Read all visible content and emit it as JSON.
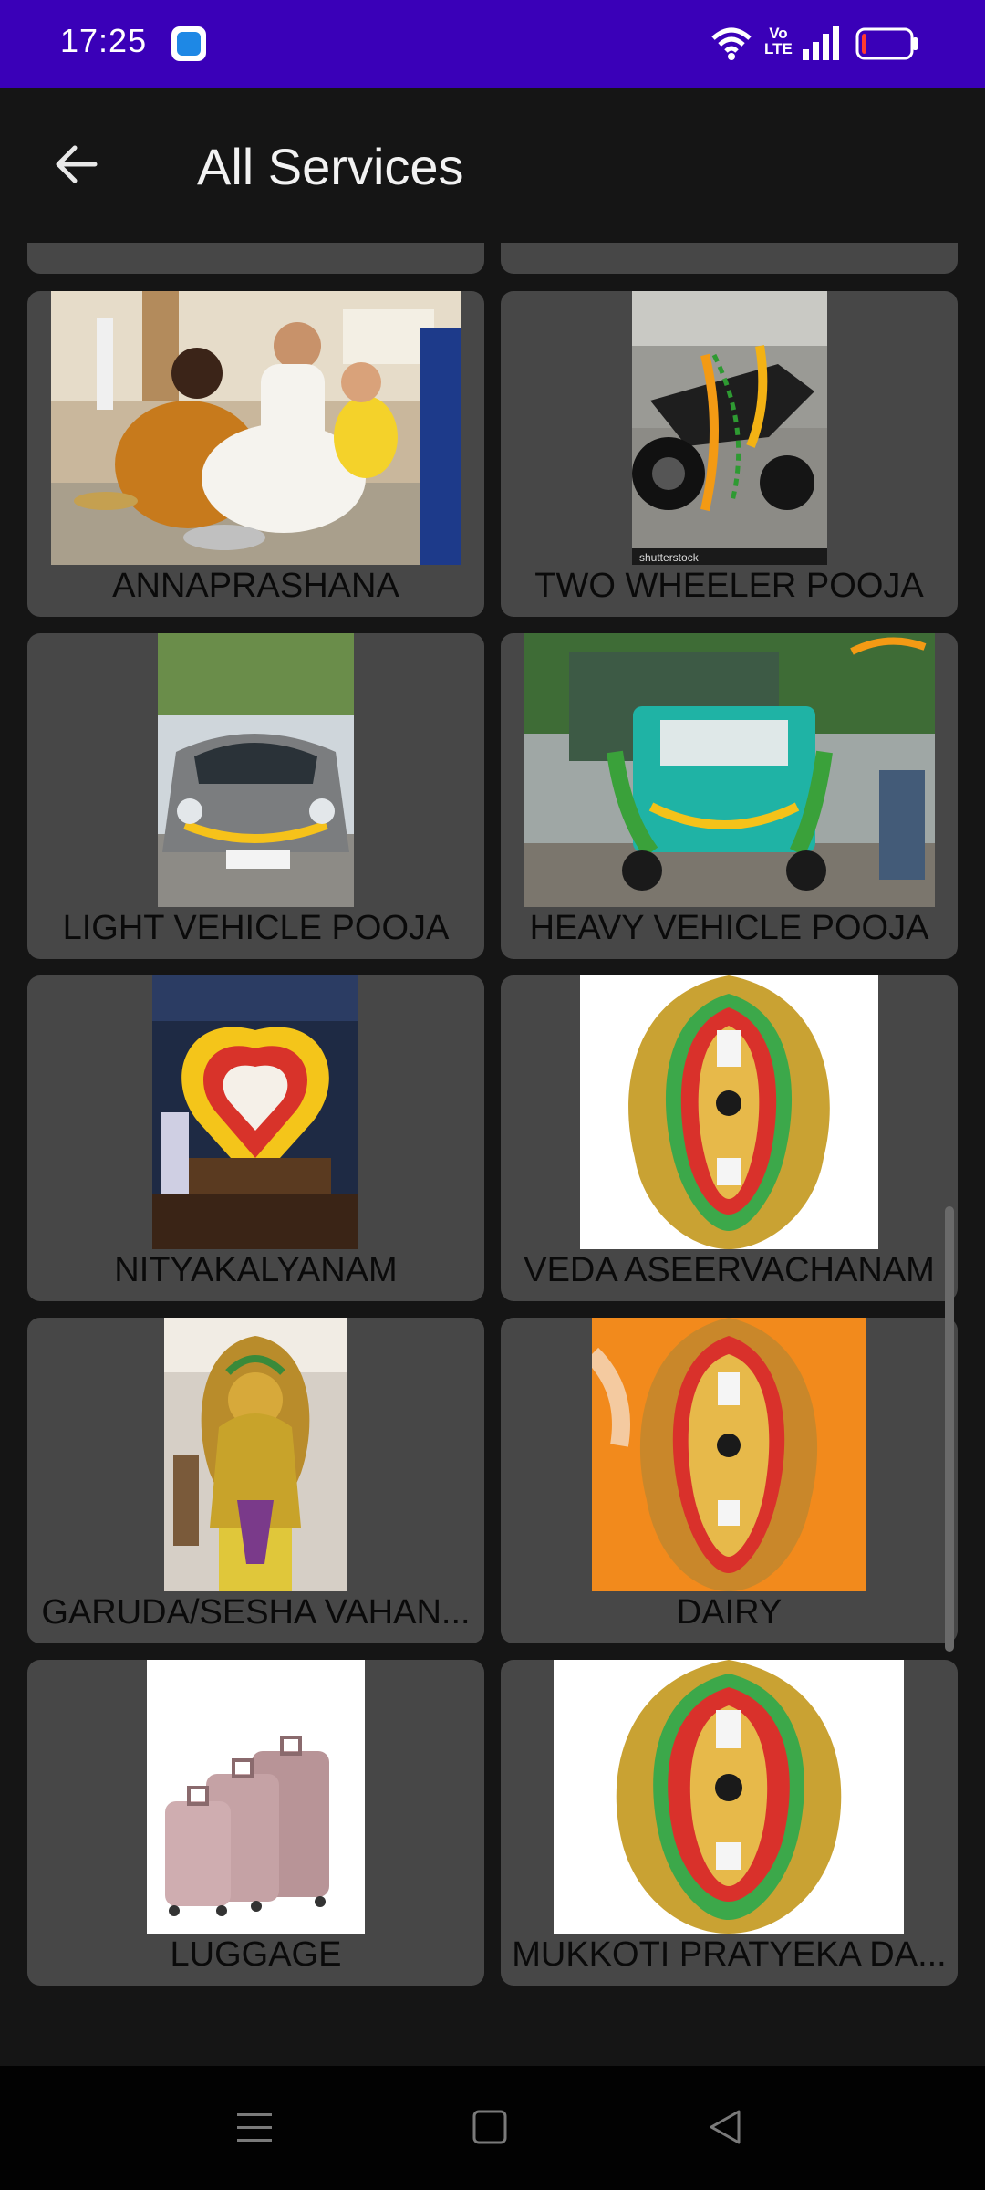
{
  "status_bar": {
    "time": "17:25",
    "network_label_top": "Vo",
    "network_label_bottom": "LTE",
    "battery_level": 0.1
  },
  "app_bar": {
    "title": "All Services"
  },
  "services": [
    {
      "label": "ANNAPRASHANA"
    },
    {
      "label": "TWO WHEELER POOJA"
    },
    {
      "label": "LIGHT VEHICLE POOJA"
    },
    {
      "label": "HEAVY VEHICLE POOJA"
    },
    {
      "label": "NITYAKALYANAM"
    },
    {
      "label": "VEDA ASEERVACHANAM"
    },
    {
      "label": "GARUDA/SESHA VAHAN..."
    },
    {
      "label": "DAIRY"
    },
    {
      "label": "LUGGAGE"
    },
    {
      "label": "MUKKOTI PRATYEKA DA..."
    }
  ],
  "photo_watermark": "shutterstock"
}
